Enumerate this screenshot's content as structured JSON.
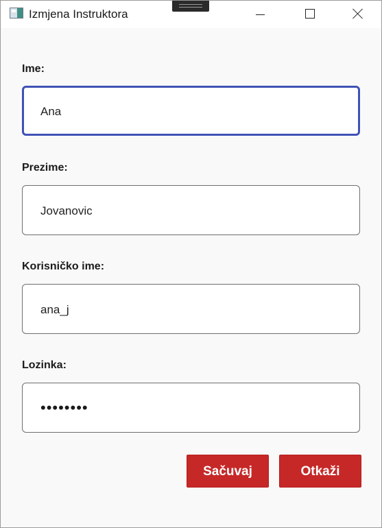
{
  "window": {
    "title": "Izmjena Instruktora"
  },
  "form": {
    "fields": [
      {
        "label": "Ime:",
        "value": "Ana"
      },
      {
        "label": "Prezime:",
        "value": "Jovanovic"
      },
      {
        "label": "Korisničko ime:",
        "value": "ana_j"
      },
      {
        "label": "Lozinka:",
        "value": "••••••••"
      }
    ]
  },
  "buttons": {
    "save_label": "Sačuvaj",
    "cancel_label": "Otkaži"
  },
  "colors": {
    "accent_button": "#c62828",
    "focus_border": "#3f51b5"
  },
  "icons": {
    "app": "app-window-icon",
    "minimize": "minimize-icon",
    "maximize": "maximize-icon",
    "close": "close-icon"
  }
}
